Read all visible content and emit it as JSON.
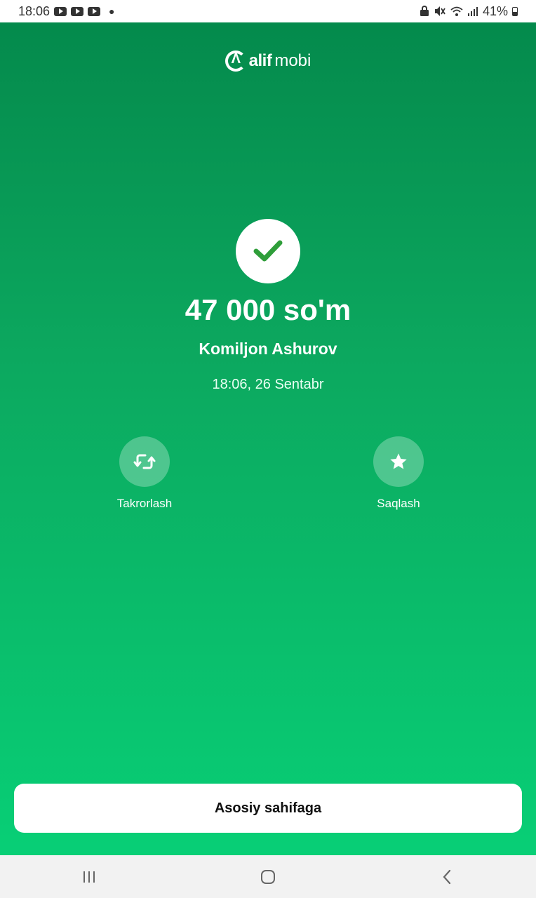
{
  "status_bar": {
    "time": "18:06",
    "battery": "41%",
    "icons": [
      "youtube-icon",
      "youtube-icon",
      "youtube-icon",
      "notification-dot",
      "lock-icon",
      "mute-icon",
      "wifi-icon",
      "signal-icon",
      "battery-icon"
    ]
  },
  "header": {
    "logo_part1": "alif",
    "logo_part2": "mobi"
  },
  "result": {
    "status_icon": "check-icon",
    "amount": "47 000 so'm",
    "recipient": "Komiljon Ashurov",
    "datetime": "18:06, 26 Sentabr"
  },
  "actions": [
    {
      "label": "Takrorlash",
      "icon": "repeat-icon"
    },
    {
      "label": "Saqlash",
      "icon": "star-icon"
    }
  ],
  "footer": {
    "home_button_label": "Asosiy sahifaga"
  },
  "nav": {
    "icons": [
      "recent-apps-icon",
      "home-icon",
      "back-icon"
    ]
  },
  "colors": {
    "gradient_top": "#048a4c",
    "gradient_bottom": "#08cf76",
    "check": "#2f9e3a"
  }
}
